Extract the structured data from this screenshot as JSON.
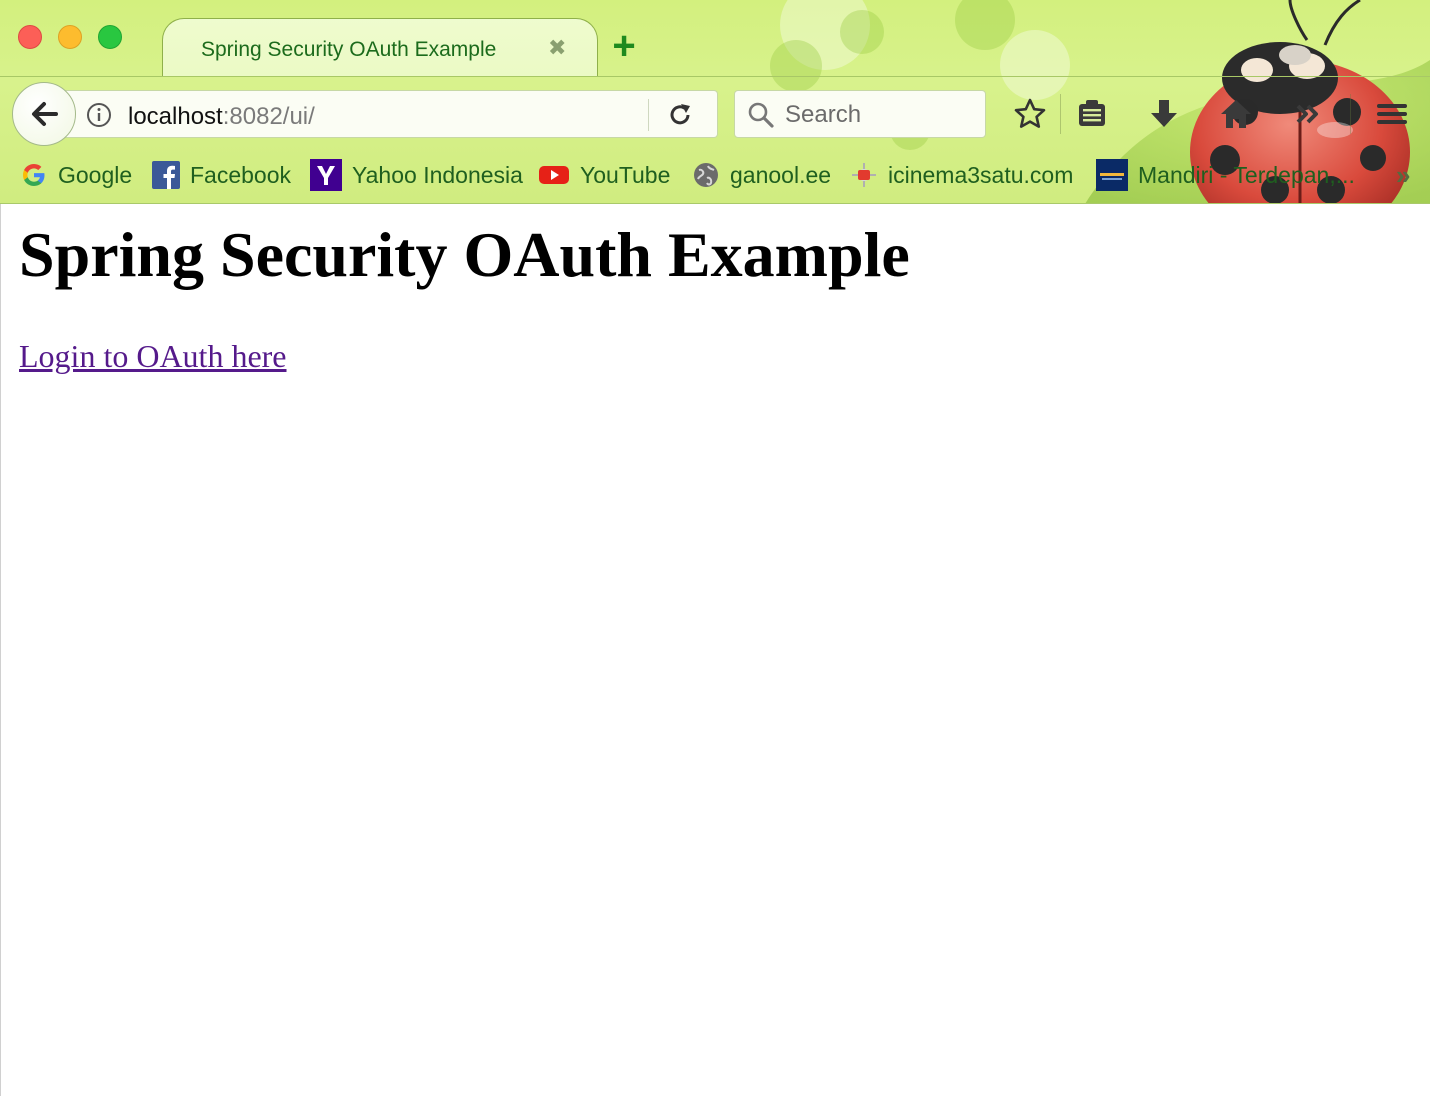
{
  "browser": {
    "tab": {
      "title": "Spring Security OAuth Example",
      "close_glyph": "✖",
      "new_tab_glyph": "+"
    },
    "url": {
      "host": "localhost",
      "path": ":8082/ui/"
    },
    "search": {
      "placeholder": "Search"
    },
    "toolbar_icons": [
      "star-icon",
      "reading-list-icon",
      "download-icon",
      "home-icon",
      "overflow-chevron-icon",
      "hamburger-menu-icon"
    ],
    "bookmarks": [
      {
        "label": "Google",
        "icon": "google-icon"
      },
      {
        "label": "Facebook",
        "icon": "facebook-icon"
      },
      {
        "label": "Yahoo Indonesia",
        "icon": "yahoo-icon"
      },
      {
        "label": "YouTube",
        "icon": "youtube-icon"
      },
      {
        "label": "ganool.ee",
        "icon": "globe-icon"
      },
      {
        "label": "icinema3satu.com",
        "icon": "icinema-icon"
      },
      {
        "label": "Mandiri - Terdepan,...",
        "icon": "mandiri-icon"
      }
    ],
    "bookmarks_overflow_glyph": "»",
    "theme_colors": {
      "chrome_green": "#d3f07e",
      "tab_text": "#1c6b1c",
      "bookmark_text": "#1f5f1f"
    }
  },
  "page": {
    "heading": "Spring Security OAuth Example",
    "link_text": "Login to OAuth here",
    "link_color": "#551a8b"
  }
}
